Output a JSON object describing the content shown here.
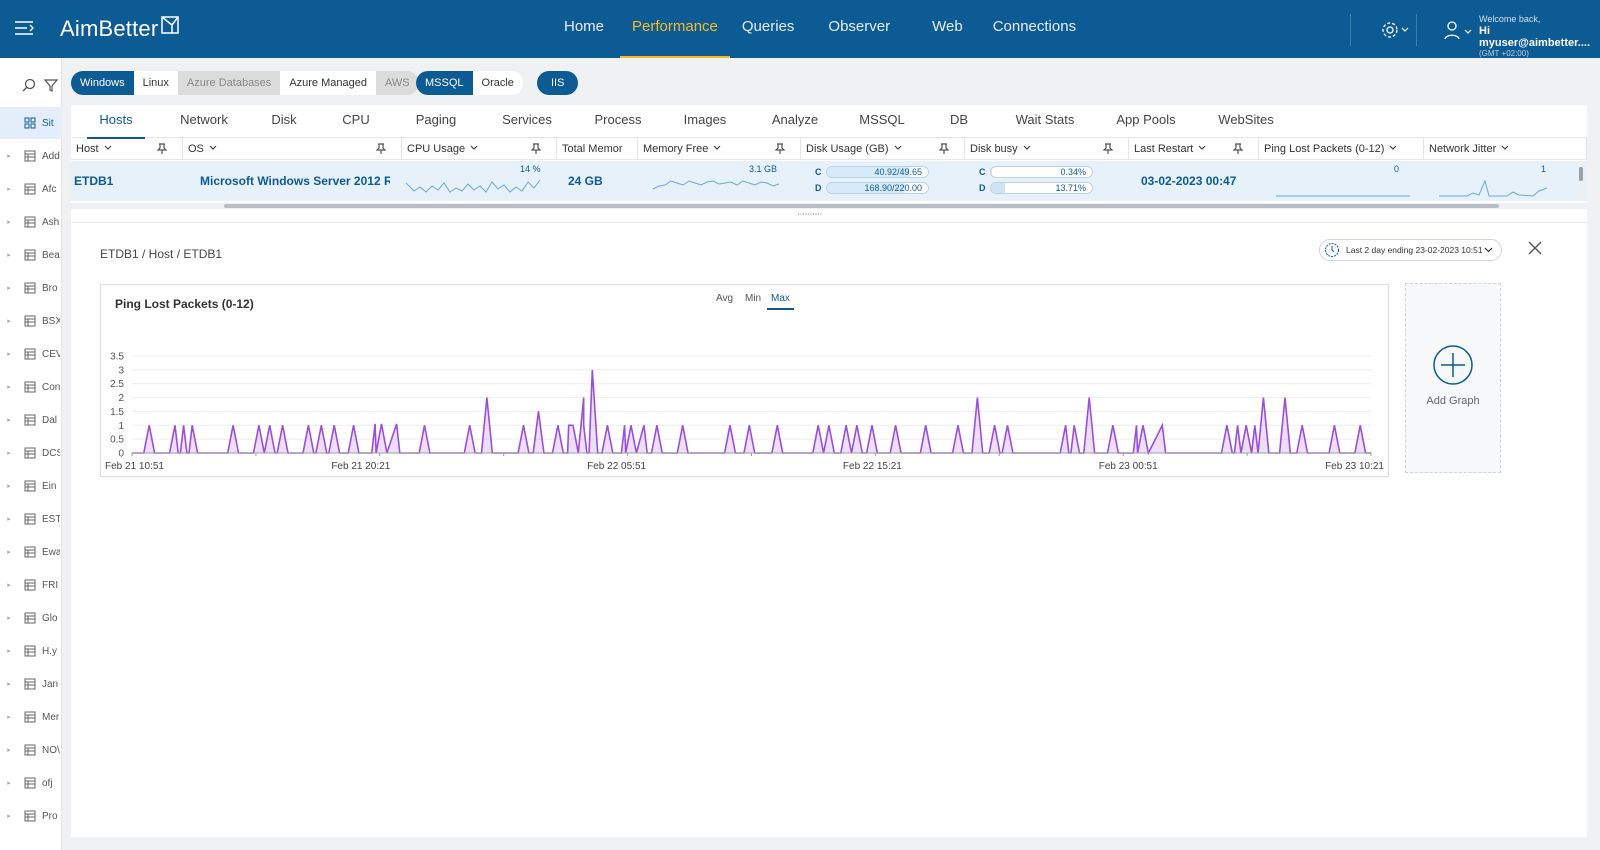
{
  "app": {
    "name": "AimBetter"
  },
  "nav": [
    {
      "label": "Home"
    },
    {
      "label": "Performance",
      "active": true
    },
    {
      "label": "Queries"
    },
    {
      "label": "Observer"
    },
    {
      "label": "Web"
    },
    {
      "label": "Connections"
    }
  ],
  "user": {
    "welcome": "Welcome back,",
    "greeting": "Hi myuser@aimbetter....",
    "timezone": "(GMT +02:00)"
  },
  "sidebar": {
    "items": [
      {
        "label": "Sit",
        "active": true
      },
      {
        "label": "Add"
      },
      {
        "label": "Afc"
      },
      {
        "label": "Ash"
      },
      {
        "label": "Bea"
      },
      {
        "label": "Bro"
      },
      {
        "label": "BSX"
      },
      {
        "label": "CEV"
      },
      {
        "label": "Con"
      },
      {
        "label": "Dal"
      },
      {
        "label": "DCS"
      },
      {
        "label": "Ein"
      },
      {
        "label": "EST"
      },
      {
        "label": "Ewa"
      },
      {
        "label": "FRI"
      },
      {
        "label": "Glo"
      },
      {
        "label": "H.y"
      },
      {
        "label": "Jan"
      },
      {
        "label": "Mer"
      },
      {
        "label": "NO\\"
      },
      {
        "label": "ofj"
      },
      {
        "label": "Pro"
      }
    ]
  },
  "filters": {
    "os": [
      {
        "label": "Windows",
        "state": "on"
      },
      {
        "label": "Linux",
        "state": "off"
      },
      {
        "label": "Azure Databases",
        "state": "disabled"
      },
      {
        "label": "Azure Managed",
        "state": "off"
      },
      {
        "label": "AWS",
        "state": "disabled"
      }
    ],
    "db": [
      {
        "label": "MSSQL",
        "state": "on"
      },
      {
        "label": "Oracle",
        "state": "off"
      }
    ],
    "web": [
      {
        "label": "IIS",
        "state": "on"
      }
    ]
  },
  "tabs": [
    {
      "label": "Hosts",
      "active": true
    },
    {
      "label": "Network"
    },
    {
      "label": "Disk"
    },
    {
      "label": "CPU"
    },
    {
      "label": "Paging"
    },
    {
      "label": "Services"
    },
    {
      "label": "Process"
    },
    {
      "label": "Images"
    },
    {
      "label": "Analyze"
    },
    {
      "label": "MSSQL"
    },
    {
      "label": "DB"
    },
    {
      "label": "Wait Stats"
    },
    {
      "label": "App Pools"
    },
    {
      "label": "WebSites"
    }
  ],
  "table": {
    "columns": [
      {
        "label": "Host"
      },
      {
        "label": "OS"
      },
      {
        "label": "CPU Usage"
      },
      {
        "label": "Total Memor"
      },
      {
        "label": "Memory Free"
      },
      {
        "label": "Disk Usage (GB)"
      },
      {
        "label": "Disk busy"
      },
      {
        "label": "Last Restart"
      },
      {
        "label": "Ping Lost Packets (0-12)"
      },
      {
        "label": "Network Jitter"
      }
    ],
    "row": {
      "host": "ETDB1",
      "os": "Microsoft Windows Server 2012 R...",
      "cpu_usage": "14 %",
      "cpu_usage_value": 14,
      "total_memory": "24 GB",
      "memory_free": "3.1 GB",
      "disk_usage": [
        {
          "drive": "C",
          "text": "40.92/49.65",
          "fraction": 0.824
        },
        {
          "drive": "D",
          "text": "168.90/220.00",
          "fraction": 0.768
        }
      ],
      "disk_busy": [
        {
          "drive": "C",
          "text": "0.34%",
          "fraction": 0.0034
        },
        {
          "drive": "D",
          "text": "13.71%",
          "fraction": 0.1371
        }
      ],
      "last_restart": "03-02-2023 00:47",
      "ping_lost": "0",
      "network_jitter": "1"
    }
  },
  "detail": {
    "breadcrumb": "ETDB1 / Host / ETDB1",
    "date_range": "Last 2 day ending  23-02-2023 10:51",
    "chart": {
      "title": "Ping Lost Packets (0-12)",
      "aggregations": [
        {
          "label": "Avg"
        },
        {
          "label": "Min"
        },
        {
          "label": "Max",
          "active": true
        }
      ]
    },
    "add_graph": "Add Graph"
  },
  "chart_data": {
    "type": "area",
    "title": "Ping Lost Packets (0-12)",
    "xlabel": "",
    "ylabel": "",
    "ylim": [
      0,
      3.5
    ],
    "yticks": [
      "0",
      "0.5",
      "1",
      "1.5",
      "2",
      "2.5",
      "3",
      "3.5"
    ],
    "xticks": [
      "Feb 21 10:51",
      "Feb 21 20:21",
      "Feb 22 05:51",
      "Feb 22 15:21",
      "Feb 23 00:51",
      "Feb 23 10:21"
    ],
    "x_range_hours": [
      0,
      47.5
    ],
    "series": [
      {
        "color": "#9b4fd6",
        "spikes": [
          [
            0.8,
            1
          ],
          [
            2.0,
            1
          ],
          [
            2.4,
            1
          ],
          [
            2.8,
            1
          ],
          [
            4.7,
            1
          ],
          [
            5.9,
            1
          ],
          [
            6.4,
            1
          ],
          [
            7.0,
            1
          ],
          [
            8.2,
            1
          ],
          [
            8.8,
            1
          ],
          [
            9.4,
            1
          ],
          [
            10.3,
            1
          ],
          [
            11.6,
            1.05
          ],
          [
            13.6,
            1
          ],
          [
            15.7,
            1
          ],
          [
            16.5,
            2
          ],
          [
            18.2,
            1
          ],
          [
            18.9,
            1.5
          ],
          [
            19.8,
            1
          ],
          [
            20.5,
            1
          ],
          [
            21.0,
            2
          ],
          [
            21.4,
            3
          ],
          [
            22.1,
            1
          ],
          [
            23.2,
            1
          ],
          [
            24.4,
            1
          ],
          [
            25.6,
            1
          ],
          [
            27.8,
            1
          ],
          [
            28.7,
            1
          ],
          [
            30.0,
            1
          ],
          [
            31.9,
            1
          ],
          [
            32.4,
            1
          ],
          [
            33.2,
            1
          ],
          [
            33.7,
            1
          ],
          [
            34.4,
            1
          ],
          [
            35.5,
            1
          ],
          [
            36.9,
            1
          ],
          [
            38.4,
            1
          ],
          [
            39.3,
            2
          ],
          [
            40.1,
            1
          ],
          [
            40.7,
            1
          ],
          [
            43.4,
            1
          ],
          [
            43.8,
            1
          ],
          [
            44.5,
            2
          ],
          [
            45.6,
            1
          ],
          [
            47.0,
            1
          ],
          [
            50.9,
            1
          ],
          [
            51.8,
            1
          ],
          [
            52.6,
            2
          ],
          [
            53.6,
            2
          ],
          [
            54.4,
            1
          ],
          [
            55.9,
            1
          ],
          [
            57.1,
            1
          ]
        ],
        "plateaus": [
          [
            11.3,
            12.3,
            1.05
          ],
          [
            20.3,
            21.0,
            1
          ],
          [
            22.9,
            23.8,
            1
          ],
          [
            46.7,
            47.9,
            1
          ],
          [
            51.4,
            52.2,
            1
          ]
        ]
      }
    ]
  },
  "colors": {
    "brand": "#0d5b94",
    "accent": "#f7b924",
    "series": "#9b4fd6"
  }
}
